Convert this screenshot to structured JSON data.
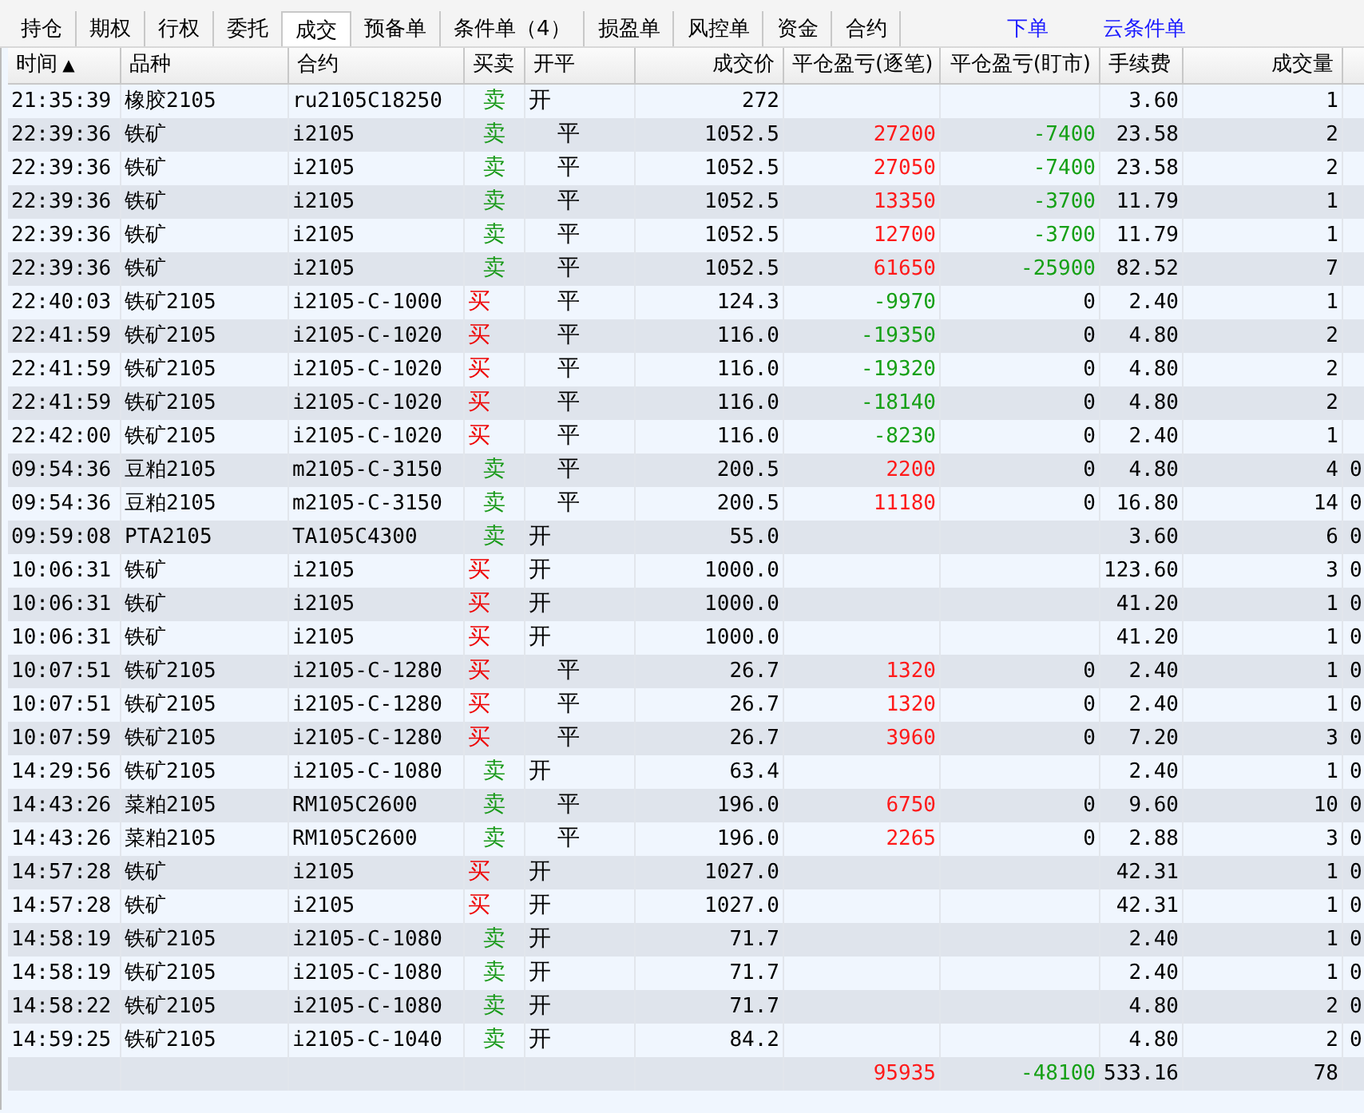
{
  "tabs": [
    {
      "label": "持仓",
      "selected": false
    },
    {
      "label": "期权",
      "selected": false
    },
    {
      "label": "行权",
      "selected": false
    },
    {
      "label": "委托",
      "selected": false
    },
    {
      "label": "成交",
      "selected": true
    },
    {
      "label": "预备单",
      "selected": false
    },
    {
      "label": "条件单（4）",
      "selected": false
    },
    {
      "label": "损盈单",
      "selected": false
    },
    {
      "label": "风控单",
      "selected": false
    },
    {
      "label": "资金",
      "selected": false
    },
    {
      "label": "合约",
      "selected": false
    }
  ],
  "links": [
    "下单",
    "云条件单"
  ],
  "table": {
    "columns": [
      {
        "label": "时间",
        "sort_mark": "▲"
      },
      {
        "label": "品种"
      },
      {
        "label": "合约"
      },
      {
        "label": "买卖"
      },
      {
        "label": "开平"
      },
      {
        "label": "成交价"
      },
      {
        "label": "平仓盈亏(逐笔)"
      },
      {
        "label": "平仓盈亏(盯市)"
      },
      {
        "label": "手续费"
      },
      {
        "label": "成交量"
      }
    ],
    "rows": [
      {
        "time": "21:35:39",
        "variety": "橡胶2105",
        "contract": "ru2105C18250",
        "side": {
          "text": "卖",
          "kind": "sell"
        },
        "offset": {
          "text": "开",
          "kind": "open"
        },
        "price": "272",
        "fee": "3.60",
        "qty": "1"
      },
      {
        "time": "22:39:36",
        "variety": "铁矿",
        "contract": "i2105",
        "side": {
          "text": "卖",
          "kind": "sell"
        },
        "offset": {
          "text": "平",
          "kind": "close"
        },
        "price": "1052.5",
        "pnl_trade": {
          "text": "27200",
          "kind": "gain"
        },
        "pnl_mtm": {
          "text": "-7400",
          "kind": "loss"
        },
        "fee": "23.58",
        "qty": "2"
      },
      {
        "time": "22:39:36",
        "variety": "铁矿",
        "contract": "i2105",
        "side": {
          "text": "卖",
          "kind": "sell"
        },
        "offset": {
          "text": "平",
          "kind": "close"
        },
        "price": "1052.5",
        "pnl_trade": {
          "text": "27050",
          "kind": "gain"
        },
        "pnl_mtm": {
          "text": "-7400",
          "kind": "loss"
        },
        "fee": "23.58",
        "qty": "2"
      },
      {
        "time": "22:39:36",
        "variety": "铁矿",
        "contract": "i2105",
        "side": {
          "text": "卖",
          "kind": "sell"
        },
        "offset": {
          "text": "平",
          "kind": "close"
        },
        "price": "1052.5",
        "pnl_trade": {
          "text": "13350",
          "kind": "gain"
        },
        "pnl_mtm": {
          "text": "-3700",
          "kind": "loss"
        },
        "fee": "11.79",
        "qty": "1"
      },
      {
        "time": "22:39:36",
        "variety": "铁矿",
        "contract": "i2105",
        "side": {
          "text": "卖",
          "kind": "sell"
        },
        "offset": {
          "text": "平",
          "kind": "close"
        },
        "price": "1052.5",
        "pnl_trade": {
          "text": "12700",
          "kind": "gain"
        },
        "pnl_mtm": {
          "text": "-3700",
          "kind": "loss"
        },
        "fee": "11.79",
        "qty": "1"
      },
      {
        "time": "22:39:36",
        "variety": "铁矿",
        "contract": "i2105",
        "side": {
          "text": "卖",
          "kind": "sell"
        },
        "offset": {
          "text": "平",
          "kind": "close"
        },
        "price": "1052.5",
        "pnl_trade": {
          "text": "61650",
          "kind": "gain"
        },
        "pnl_mtm": {
          "text": "-25900",
          "kind": "loss"
        },
        "fee": "82.52",
        "qty": "7"
      },
      {
        "time": "22:40:03",
        "variety": "铁矿2105",
        "contract": "i2105-C-1000",
        "side": {
          "text": "买",
          "kind": "buy"
        },
        "offset": {
          "text": "平",
          "kind": "close"
        },
        "price": "124.3",
        "pnl_trade": {
          "text": "-9970",
          "kind": "loss"
        },
        "pnl_mtm": {
          "text": "0",
          "kind": "flat"
        },
        "fee": "2.40",
        "qty": "1"
      },
      {
        "time": "22:41:59",
        "variety": "铁矿2105",
        "contract": "i2105-C-1020",
        "side": {
          "text": "买",
          "kind": "buy"
        },
        "offset": {
          "text": "平",
          "kind": "close"
        },
        "price": "116.0",
        "pnl_trade": {
          "text": "-19350",
          "kind": "loss"
        },
        "pnl_mtm": {
          "text": "0",
          "kind": "flat"
        },
        "fee": "4.80",
        "qty": "2"
      },
      {
        "time": "22:41:59",
        "variety": "铁矿2105",
        "contract": "i2105-C-1020",
        "side": {
          "text": "买",
          "kind": "buy"
        },
        "offset": {
          "text": "平",
          "kind": "close"
        },
        "price": "116.0",
        "pnl_trade": {
          "text": "-19320",
          "kind": "loss"
        },
        "pnl_mtm": {
          "text": "0",
          "kind": "flat"
        },
        "fee": "4.80",
        "qty": "2"
      },
      {
        "time": "22:41:59",
        "variety": "铁矿2105",
        "contract": "i2105-C-1020",
        "side": {
          "text": "买",
          "kind": "buy"
        },
        "offset": {
          "text": "平",
          "kind": "close"
        },
        "price": "116.0",
        "pnl_trade": {
          "text": "-18140",
          "kind": "loss"
        },
        "pnl_mtm": {
          "text": "0",
          "kind": "flat"
        },
        "fee": "4.80",
        "qty": "2"
      },
      {
        "time": "22:42:00",
        "variety": "铁矿2105",
        "contract": "i2105-C-1020",
        "side": {
          "text": "买",
          "kind": "buy"
        },
        "offset": {
          "text": "平",
          "kind": "close"
        },
        "price": "116.0",
        "pnl_trade": {
          "text": "-8230",
          "kind": "loss"
        },
        "pnl_mtm": {
          "text": "0",
          "kind": "flat"
        },
        "fee": "2.40",
        "qty": "1"
      },
      {
        "time": "09:54:36",
        "variety": "豆粕2105",
        "contract": "m2105-C-3150",
        "side": {
          "text": "卖",
          "kind": "sell"
        },
        "offset": {
          "text": "平",
          "kind": "close"
        },
        "price": "200.5",
        "pnl_trade": {
          "text": "2200",
          "kind": "gain"
        },
        "pnl_mtm": {
          "text": "0",
          "kind": "flat"
        },
        "fee": "4.80",
        "qty": "4",
        "column_11": "0"
      },
      {
        "time": "09:54:36",
        "variety": "豆粕2105",
        "contract": "m2105-C-3150",
        "side": {
          "text": "卖",
          "kind": "sell"
        },
        "offset": {
          "text": "平",
          "kind": "close"
        },
        "price": "200.5",
        "pnl_trade": {
          "text": "11180",
          "kind": "gain"
        },
        "pnl_mtm": {
          "text": "0",
          "kind": "flat"
        },
        "fee": "16.80",
        "qty": "14",
        "column_11": "0"
      },
      {
        "time": "09:59:08",
        "variety": "PTA2105",
        "contract": "TA105C4300",
        "side": {
          "text": "卖",
          "kind": "sell"
        },
        "offset": {
          "text": "开",
          "kind": "open"
        },
        "price": "55.0",
        "fee": "3.60",
        "qty": "6",
        "column_11": "0"
      },
      {
        "time": "10:06:31",
        "variety": "铁矿",
        "contract": "i2105",
        "side": {
          "text": "买",
          "kind": "buy"
        },
        "offset": {
          "text": "开",
          "kind": "open"
        },
        "price": "1000.0",
        "fee": "123.60",
        "qty": "3",
        "column_11": "0"
      },
      {
        "time": "10:06:31",
        "variety": "铁矿",
        "contract": "i2105",
        "side": {
          "text": "买",
          "kind": "buy"
        },
        "offset": {
          "text": "开",
          "kind": "open"
        },
        "price": "1000.0",
        "fee": "41.20",
        "qty": "1",
        "column_11": "0"
      },
      {
        "time": "10:06:31",
        "variety": "铁矿",
        "contract": "i2105",
        "side": {
          "text": "买",
          "kind": "buy"
        },
        "offset": {
          "text": "开",
          "kind": "open"
        },
        "price": "1000.0",
        "fee": "41.20",
        "qty": "1",
        "column_11": "0"
      },
      {
        "time": "10:07:51",
        "variety": "铁矿2105",
        "contract": "i2105-C-1280",
        "side": {
          "text": "买",
          "kind": "buy"
        },
        "offset": {
          "text": "平",
          "kind": "close"
        },
        "price": "26.7",
        "pnl_trade": {
          "text": "1320",
          "kind": "gain"
        },
        "pnl_mtm": {
          "text": "0",
          "kind": "flat"
        },
        "fee": "2.40",
        "qty": "1",
        "column_11": "0"
      },
      {
        "time": "10:07:51",
        "variety": "铁矿2105",
        "contract": "i2105-C-1280",
        "side": {
          "text": "买",
          "kind": "buy"
        },
        "offset": {
          "text": "平",
          "kind": "close"
        },
        "price": "26.7",
        "pnl_trade": {
          "text": "1320",
          "kind": "gain"
        },
        "pnl_mtm": {
          "text": "0",
          "kind": "flat"
        },
        "fee": "2.40",
        "qty": "1",
        "column_11": "0"
      },
      {
        "time": "10:07:59",
        "variety": "铁矿2105",
        "contract": "i2105-C-1280",
        "side": {
          "text": "买",
          "kind": "buy"
        },
        "offset": {
          "text": "平",
          "kind": "close"
        },
        "price": "26.7",
        "pnl_trade": {
          "text": "3960",
          "kind": "gain"
        },
        "pnl_mtm": {
          "text": "0",
          "kind": "flat"
        },
        "fee": "7.20",
        "qty": "3",
        "column_11": "0"
      },
      {
        "time": "14:29:56",
        "variety": "铁矿2105",
        "contract": "i2105-C-1080",
        "side": {
          "text": "卖",
          "kind": "sell"
        },
        "offset": {
          "text": "开",
          "kind": "open"
        },
        "price": "63.4",
        "fee": "2.40",
        "qty": "1",
        "column_11": "0"
      },
      {
        "time": "14:43:26",
        "variety": "菜粕2105",
        "contract": "RM105C2600",
        "side": {
          "text": "卖",
          "kind": "sell"
        },
        "offset": {
          "text": "平",
          "kind": "close"
        },
        "price": "196.0",
        "pnl_trade": {
          "text": "6750",
          "kind": "gain"
        },
        "pnl_mtm": {
          "text": "0",
          "kind": "flat"
        },
        "fee": "9.60",
        "qty": "10",
        "column_11": "0"
      },
      {
        "time": "14:43:26",
        "variety": "菜粕2105",
        "contract": "RM105C2600",
        "side": {
          "text": "卖",
          "kind": "sell"
        },
        "offset": {
          "text": "平",
          "kind": "close"
        },
        "price": "196.0",
        "pnl_trade": {
          "text": "2265",
          "kind": "gain"
        },
        "pnl_mtm": {
          "text": "0",
          "kind": "flat"
        },
        "fee": "2.88",
        "qty": "3",
        "column_11": "0"
      },
      {
        "time": "14:57:28",
        "variety": "铁矿",
        "contract": "i2105",
        "side": {
          "text": "买",
          "kind": "buy"
        },
        "offset": {
          "text": "开",
          "kind": "open"
        },
        "price": "1027.0",
        "fee": "42.31",
        "qty": "1",
        "column_11": "0"
      },
      {
        "time": "14:57:28",
        "variety": "铁矿",
        "contract": "i2105",
        "side": {
          "text": "买",
          "kind": "buy"
        },
        "offset": {
          "text": "开",
          "kind": "open"
        },
        "price": "1027.0",
        "fee": "42.31",
        "qty": "1",
        "column_11": "0"
      },
      {
        "time": "14:58:19",
        "variety": "铁矿2105",
        "contract": "i2105-C-1080",
        "side": {
          "text": "卖",
          "kind": "sell"
        },
        "offset": {
          "text": "开",
          "kind": "open"
        },
        "price": "71.7",
        "fee": "2.40",
        "qty": "1",
        "column_11": "0"
      },
      {
        "time": "14:58:19",
        "variety": "铁矿2105",
        "contract": "i2105-C-1080",
        "side": {
          "text": "卖",
          "kind": "sell"
        },
        "offset": {
          "text": "开",
          "kind": "open"
        },
        "price": "71.7",
        "fee": "2.40",
        "qty": "1",
        "column_11": "0"
      },
      {
        "time": "14:58:22",
        "variety": "铁矿2105",
        "contract": "i2105-C-1080",
        "side": {
          "text": "卖",
          "kind": "sell"
        },
        "offset": {
          "text": "开",
          "kind": "open"
        },
        "price": "71.7",
        "fee": "4.80",
        "qty": "2",
        "column_11": "0"
      },
      {
        "time": "14:59:25",
        "variety": "铁矿2105",
        "contract": "i2105-C-1040",
        "side": {
          "text": "卖",
          "kind": "sell"
        },
        "offset": {
          "text": "开",
          "kind": "open"
        },
        "price": "84.2",
        "fee": "4.80",
        "qty": "2",
        "column_11": "0"
      }
    ],
    "total": {
      "pnl_trade": {
        "text": "95935",
        "kind": "gain"
      },
      "pnl_mtm": {
        "text": "-48100",
        "kind": "loss"
      },
      "fee": "533.16",
      "qty": "78"
    }
  }
}
